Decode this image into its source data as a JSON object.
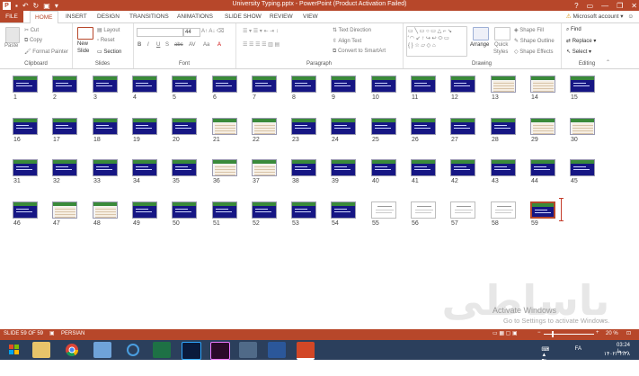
{
  "window": {
    "title": "University Typing.pptx - PowerPoint (Product Activation Failed)",
    "qat": [
      "save-icon",
      "undo-icon",
      "redo-icon",
      "present-icon",
      "customize-icon"
    ],
    "controls": [
      "?",
      "▭",
      "—",
      "❐",
      "✕"
    ]
  },
  "tabs": [
    "FILE",
    "HOME",
    "INSERT",
    "DESIGN",
    "TRANSITIONS",
    "ANIMATIONS",
    "SLIDE SHOW",
    "REVIEW",
    "VIEW"
  ],
  "account": "Microsoft account",
  "ribbon": {
    "clipboard": {
      "label": "Clipboard",
      "paste": "Paste",
      "cut": "Cut",
      "copy": "Copy",
      "format_painter": "Format Painter"
    },
    "slides": {
      "label": "Slides",
      "new_slide_1": "New",
      "new_slide_2": "Slide",
      "layout": "Layout",
      "reset": "Reset",
      "section": "Section"
    },
    "font": {
      "label": "Font",
      "size": "44",
      "bold": "B",
      "italic": "I",
      "underline": "U",
      "strike": "S",
      "shadow": "abc",
      "spacing": "AV",
      "case": "Aa",
      "color": "A"
    },
    "paragraph": {
      "label": "Paragraph",
      "text_direction": "Text Direction",
      "align_text": "Align Text",
      "smartart": "Convert to SmartArt"
    },
    "drawing": {
      "label": "Drawing",
      "arrange": "Arrange",
      "quick_styles_1": "Quick",
      "quick_styles_2": "Styles",
      "shape_fill": "Shape Fill",
      "shape_outline": "Shape Outline",
      "shape_effects": "Shape Effects"
    },
    "editing": {
      "label": "Editing",
      "find": "Find",
      "replace": "Replace",
      "select": "Select"
    }
  },
  "slides": {
    "count": 59,
    "selected": 59,
    "types": {
      "13": "table",
      "14": "table",
      "21": "table",
      "22": "table",
      "29": "table",
      "30": "table",
      "36": "table",
      "37": "table",
      "47": "table",
      "48": "table",
      "55": "white",
      "56": "white",
      "57": "white",
      "58": "white"
    }
  },
  "watermark": {
    "brand": "باساطی",
    "activate_1": "Activate Windows",
    "activate_2": "Go to Settings to activate Windows."
  },
  "status": {
    "slide": "SLIDE 59 OF 59",
    "language": "PERSIAN",
    "zoom": "20 %"
  },
  "taskbar": {
    "apps": [
      "start-icon",
      "explorer-icon",
      "chrome-icon",
      "outlook-icon",
      "sync-icon",
      "excel-icon",
      "photoshop-icon",
      "premiere-icon",
      "chat-icon",
      "word-icon",
      "powerpoint-icon"
    ]
  },
  "tray": {
    "lang": "FA",
    "time": "03:24 ب.ظ",
    "date": "۱۴۰۲/۰۲/۲۸"
  },
  "colors": {
    "accent": "#b7472a",
    "slide_blue": "#161684",
    "slide_green": "#3a8a3a",
    "taskbar": "#2b3f5c"
  }
}
